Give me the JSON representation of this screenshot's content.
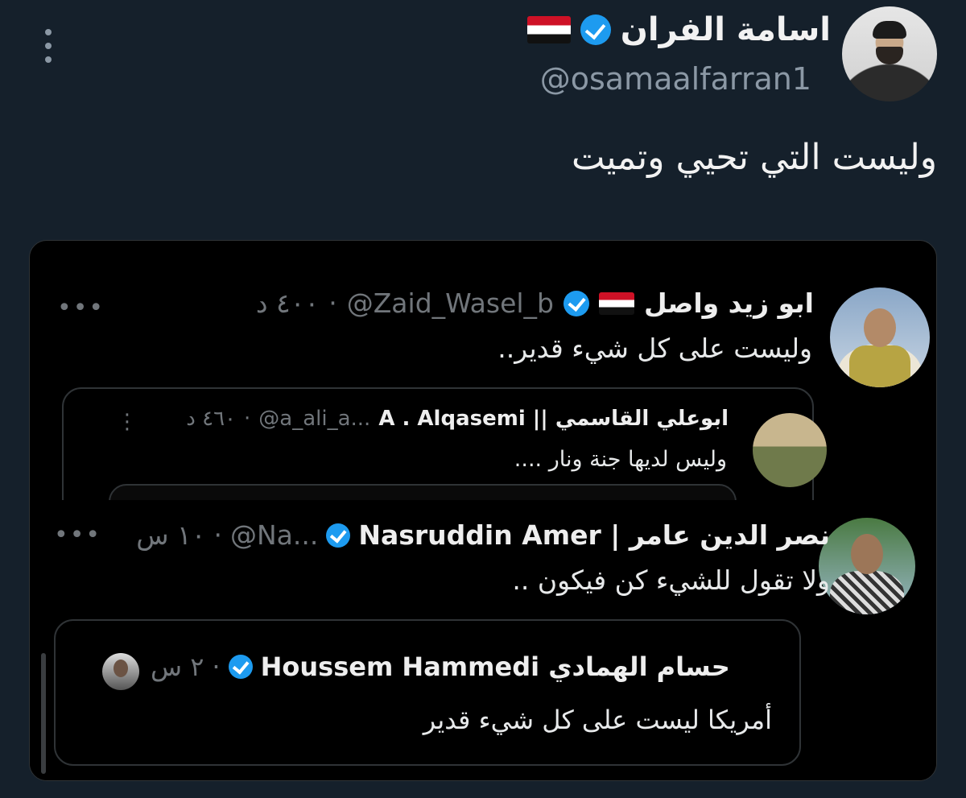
{
  "tweet": {
    "author_name": "اسامة الفران",
    "author_handle": "@osamaalfarran1",
    "text": "وليست التي تحيي وتميت"
  },
  "embedded": {
    "tweet1": {
      "name": "ابو زيد واصل",
      "handle": "@Zaid_Wasel_b",
      "time": "٤٠٠ د",
      "text": "وليست على كل شيء قدير..",
      "quoted": {
        "name": "ابوعلي القاسمي || A . Alqasemi",
        "handle": "@a_ali_a...",
        "time": "٤٦٠ د",
        "text": "وليس لديها جنة ونار ...."
      }
    },
    "tweet2": {
      "name": "نصر الدين عامر | Nasruddin Amer",
      "handle": "@Na...",
      "time": "١٠ س",
      "text": "ولا تقول للشيء كن فيكون ..",
      "quoted": {
        "name": "حسام الهمادي Houssem Hammedi",
        "time": "٢ س",
        "text": "أمريكا ليست على كل شيء قدير"
      }
    }
  },
  "colors": {
    "background": "#15202b",
    "embed_background": "#000000",
    "verified_badge": "#1d9bf0",
    "secondary_text": "#8b98a5"
  },
  "icons": [
    "more-vertical-icon",
    "verified-badge-icon",
    "yemen-flag-icon",
    "more-horizontal-icon"
  ]
}
